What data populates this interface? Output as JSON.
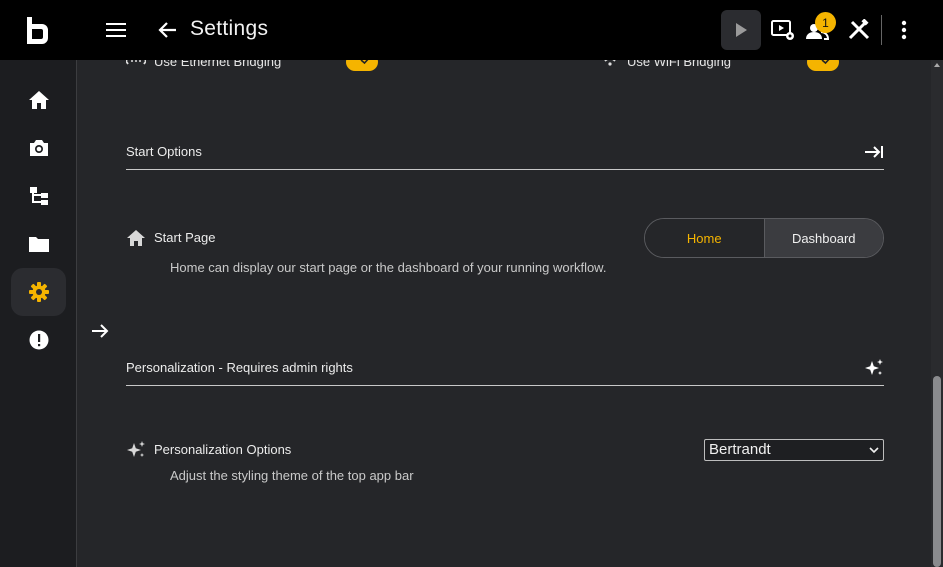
{
  "topbar": {
    "title": "Settings",
    "notification_count": "1",
    "colors": {
      "background": "#000000",
      "badge": "#f5b400"
    }
  },
  "sidebar": {
    "items": [
      {
        "name": "home",
        "icon": "home-icon",
        "active": false
      },
      {
        "name": "camera",
        "icon": "camera-icon",
        "active": false
      },
      {
        "name": "workflow",
        "icon": "hierarchy-icon",
        "active": false
      },
      {
        "name": "files",
        "icon": "folder-icon",
        "active": false
      },
      {
        "name": "settings",
        "icon": "gear-icon",
        "active": true
      },
      {
        "name": "alerts",
        "icon": "alert-icon",
        "active": false
      }
    ]
  },
  "bridging": {
    "ethernet_label": "Use Ethernet Bridging",
    "wifi_label": "Use WiFi Bridging"
  },
  "start_options": {
    "section_title": "Start Options",
    "start_page_label": "Start Page",
    "start_page_desc": "Home can display our start page or the dashboard of your running workflow.",
    "options": [
      "Home",
      "Dashboard"
    ],
    "selected": "Home"
  },
  "personalization": {
    "section_title": "Personalization - Requires admin rights",
    "options_label": "Personalization Options",
    "options_desc": "Adjust the styling theme of the top app bar",
    "selected_theme": "Bertrandt"
  },
  "accent_color": "#f5b400"
}
